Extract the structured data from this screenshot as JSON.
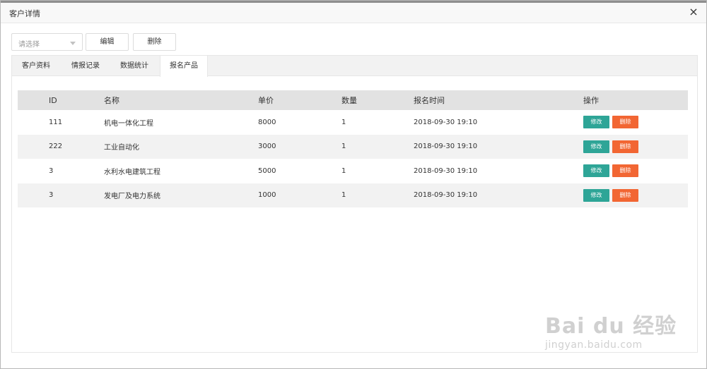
{
  "dialog": {
    "title": "客户详情",
    "close_symbol": "×"
  },
  "toolbar": {
    "select_placeholder": "请选择",
    "edit_label": "编辑",
    "delete_label": "删除"
  },
  "tabs": [
    {
      "label": "客户资料",
      "active": false
    },
    {
      "label": "情报记录",
      "active": false
    },
    {
      "label": "数据统计",
      "active": false
    },
    {
      "label": "报名产品",
      "active": true
    }
  ],
  "table": {
    "headers": {
      "id": "ID",
      "name": "名称",
      "price": "单价",
      "qty": "数量",
      "time": "报名时间",
      "ops": "操作"
    },
    "rows": [
      {
        "id": "111",
        "name": "机电一体化工程",
        "price": "8000",
        "qty": "1",
        "time": "2018-09-30 19:10"
      },
      {
        "id": "222",
        "name": "工业自动化",
        "price": "3000",
        "qty": "1",
        "time": "2018-09-30 19:10"
      },
      {
        "id": "3",
        "name": "水利水电建筑工程",
        "price": "5000",
        "qty": "1",
        "time": "2018-09-30 19:10"
      },
      {
        "id": "3",
        "name": "发电厂及电力系统",
        "price": "1000",
        "qty": "1",
        "time": "2018-09-30 19:10"
      }
    ],
    "row_edit_label": "修改",
    "row_delete_label": "删除"
  },
  "watermark": {
    "brand": "Bai du 经验",
    "url": "jingyan.baidu.com"
  },
  "colors": {
    "edit_button": "#2ea597",
    "delete_button": "#f26633",
    "header_bg": "#e2e2e2",
    "stripe_bg": "#f2f2f2"
  }
}
